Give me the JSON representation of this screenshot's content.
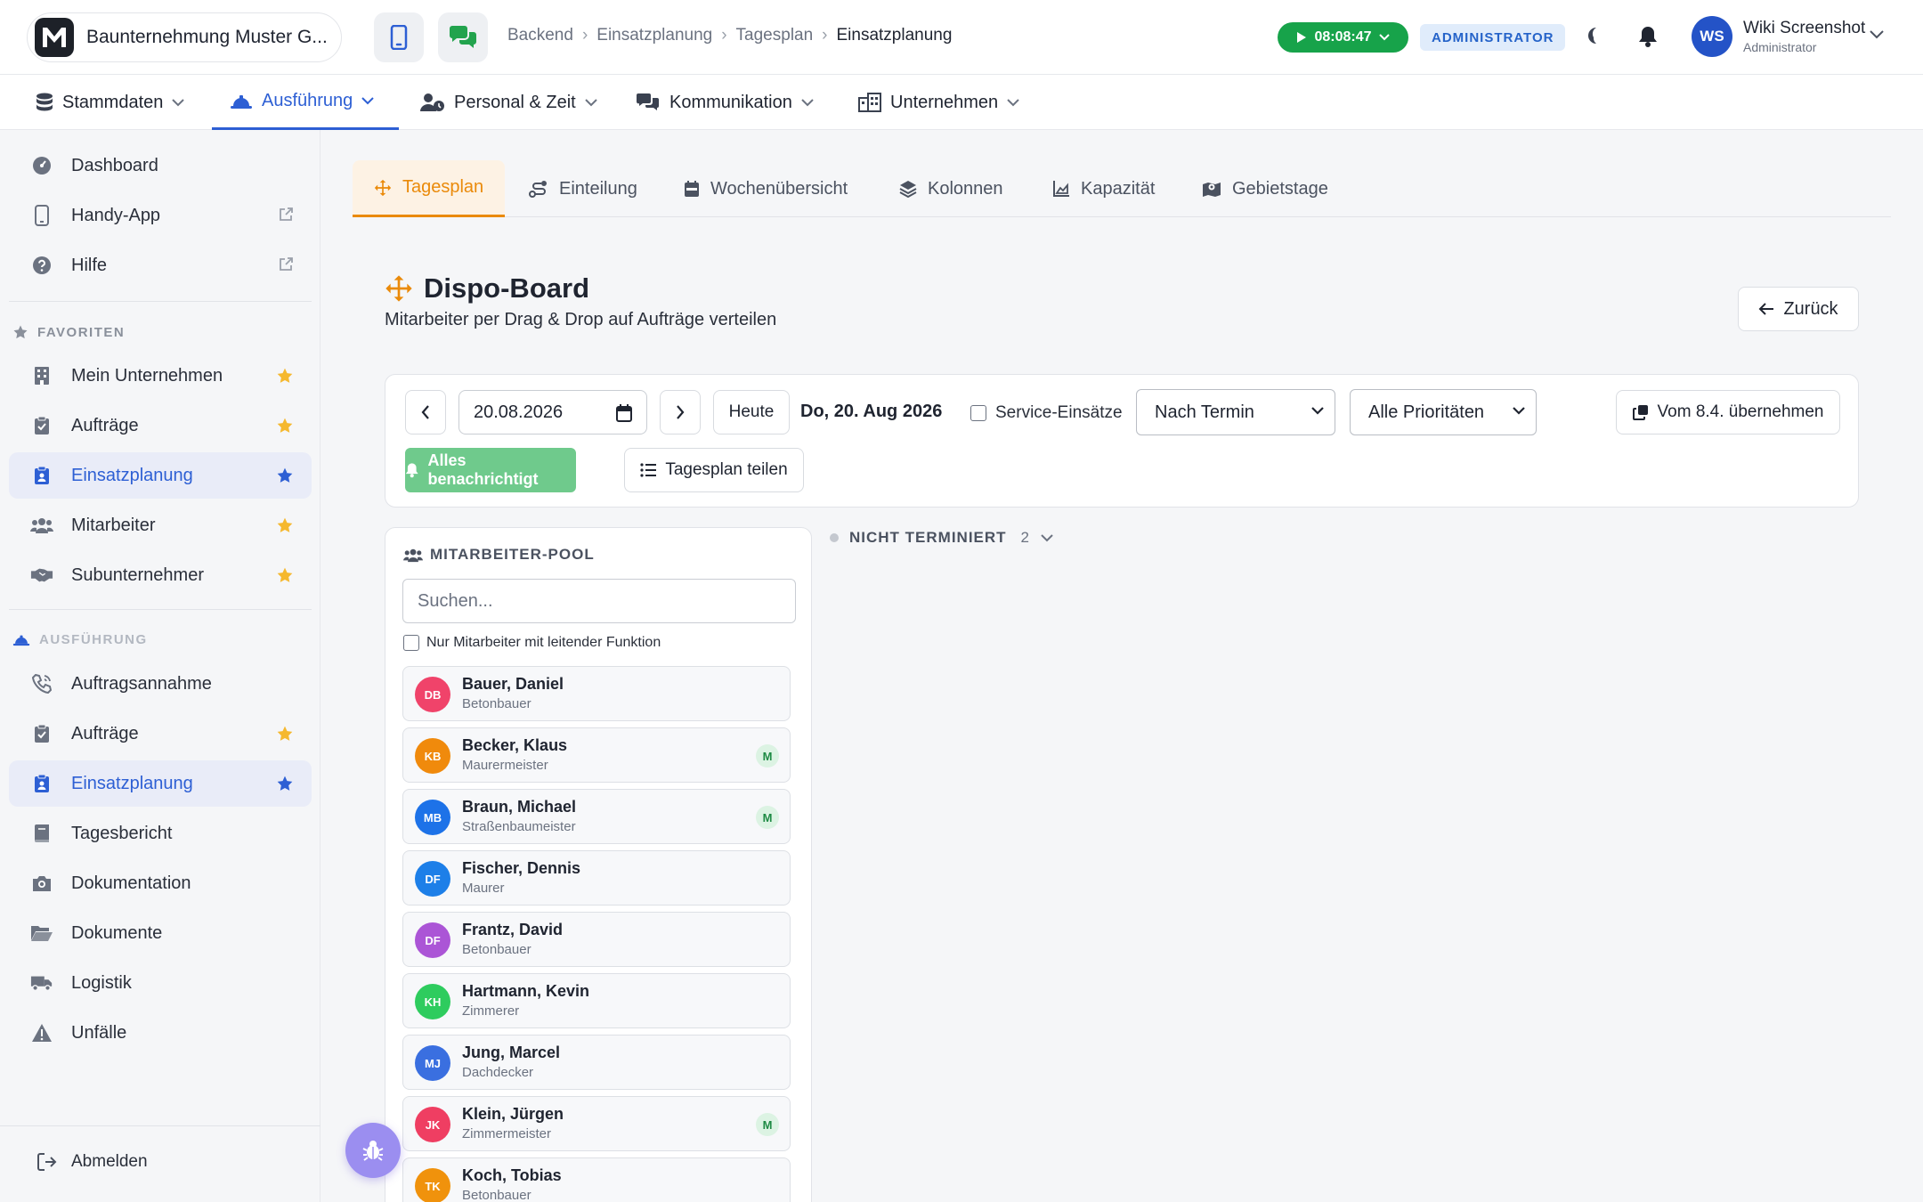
{
  "header": {
    "company_name": "Baunternehmung Muster G...",
    "breadcrumb": [
      "Backend",
      "Einsatzplanung",
      "Tagesplan",
      "Einsatzplanung"
    ],
    "timer": "08:08:47",
    "role_badge": "ADMINISTRATOR",
    "avatar_initials": "WS",
    "user_name": "Wiki Screenshot",
    "user_role": "Administrator"
  },
  "main_nav": [
    {
      "label": "Stammdaten",
      "icon": "database-icon"
    },
    {
      "label": "Ausführung",
      "icon": "hard-hat-icon",
      "active": true
    },
    {
      "label": "Personal & Zeit",
      "icon": "user-clock-icon"
    },
    {
      "label": "Kommunikation",
      "icon": "chat-icon"
    },
    {
      "label": "Unternehmen",
      "icon": "city-icon"
    }
  ],
  "sidebar": {
    "top_items": [
      {
        "label": "Dashboard",
        "icon": "gauge-icon"
      },
      {
        "label": "Handy-App",
        "icon": "mobile-icon",
        "external": true
      },
      {
        "label": "Hilfe",
        "icon": "help-icon",
        "external": true
      }
    ],
    "favorites_title": "FAVORITEN",
    "favorites": [
      {
        "label": "Mein Unternehmen",
        "icon": "building-icon"
      },
      {
        "label": "Aufträge",
        "icon": "clipboard-check-icon"
      },
      {
        "label": "Einsatzplanung",
        "icon": "clipboard-user-icon",
        "active": true
      },
      {
        "label": "Mitarbeiter",
        "icon": "users-icon"
      },
      {
        "label": "Subunternehmer",
        "icon": "handshake-icon"
      }
    ],
    "execution_title": "AUSFÜHRUNG",
    "execution": [
      {
        "label": "Auftragsannahme",
        "icon": "phone-icon"
      },
      {
        "label": "Aufträge",
        "icon": "clipboard-check-icon",
        "star": true
      },
      {
        "label": "Einsatzplanung",
        "icon": "clipboard-user-icon",
        "star": true,
        "active": true
      },
      {
        "label": "Tagesbericht",
        "icon": "book-icon"
      },
      {
        "label": "Dokumentation",
        "icon": "camera-icon"
      },
      {
        "label": "Dokumente",
        "icon": "folder-open-icon"
      },
      {
        "label": "Logistik",
        "icon": "truck-icon"
      },
      {
        "label": "Unfälle",
        "icon": "warning-icon"
      }
    ],
    "logout": "Abmelden"
  },
  "tabs": [
    {
      "label": "Tagesplan",
      "icon": "arrows-move-icon",
      "active": true
    },
    {
      "label": "Einteilung",
      "icon": "route-icon"
    },
    {
      "label": "Wochenübersicht",
      "icon": "calendar-week-icon"
    },
    {
      "label": "Kolonnen",
      "icon": "layers-icon"
    },
    {
      "label": "Kapazität",
      "icon": "chart-area-icon"
    },
    {
      "label": "Gebietstage",
      "icon": "map-location-icon"
    }
  ],
  "page": {
    "title": "Dispo-Board",
    "subtitle": "Mitarbeiter per Drag & Drop auf Aufträge verteilen",
    "back_label": "Zurück"
  },
  "toolbar": {
    "date_value": "20.08.2026",
    "today_label": "Heute",
    "date_display": "Do, 20. Aug 2026",
    "service_label": "Service-Einsätze",
    "sort_selected": "Nach Termin",
    "priority_selected": "Alle Prioritäten",
    "copy_label": "Vom 8.4. übernehmen",
    "notify_label": "Alles benachrichtigt",
    "share_label": "Tagesplan teilen"
  },
  "pool": {
    "title": "MITARBEITER-POOL",
    "search_placeholder": "Suchen...",
    "filter_label": "Nur Mitarbeiter mit leitender Funktion",
    "employees": [
      {
        "initials": "DB",
        "name": "Bauer, Daniel",
        "job": "Betonbauer",
        "color": "#f0436a",
        "badge": ""
      },
      {
        "initials": "KB",
        "name": "Becker, Klaus",
        "job": "Maurermeister",
        "color": "#f08a0c",
        "badge": "M"
      },
      {
        "initials": "MB",
        "name": "Braun, Michael",
        "job": "Straßenbaumeister",
        "color": "#1d72e8",
        "badge": "M"
      },
      {
        "initials": "DF",
        "name": "Fischer, Dennis",
        "job": "Maurer",
        "color": "#1d7fe8",
        "badge": ""
      },
      {
        "initials": "DF",
        "name": "Frantz, David",
        "job": "Betonbauer",
        "color": "#ab55d6",
        "badge": ""
      },
      {
        "initials": "KH",
        "name": "Hartmann, Kevin",
        "job": "Zimmerer",
        "color": "#2ecc5e",
        "badge": ""
      },
      {
        "initials": "MJ",
        "name": "Jung, Marcel",
        "job": "Dachdecker",
        "color": "#3a6fe0",
        "badge": ""
      },
      {
        "initials": "JK",
        "name": "Klein, Jürgen",
        "job": "Zimmermeister",
        "color": "#ef3e62",
        "badge": "M"
      },
      {
        "initials": "TK",
        "name": "Koch, Tobias",
        "job": "Betonbauer",
        "color": "#f0920c",
        "badge": ""
      }
    ]
  },
  "unscheduled": {
    "label": "NICHT TERMINIERT",
    "count": "2"
  }
}
